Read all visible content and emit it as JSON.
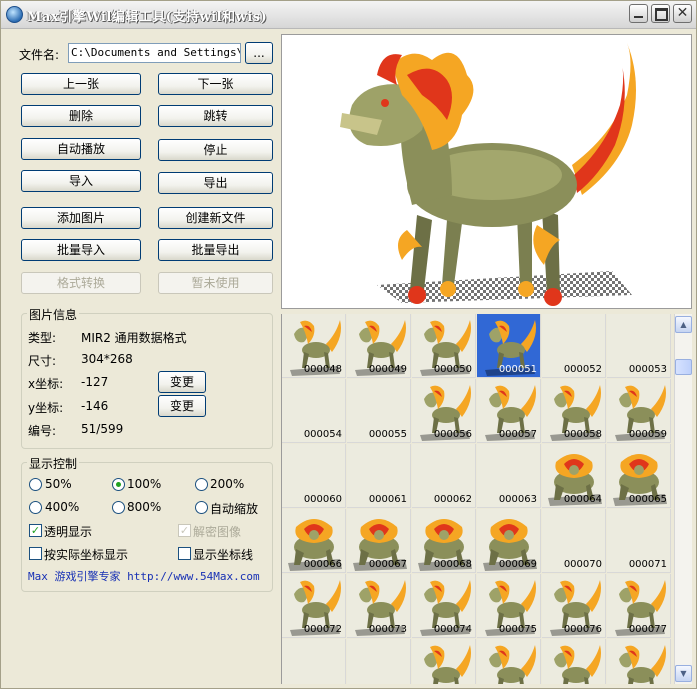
{
  "window": {
    "title": "Max引擎Wil编辑工具(支持wil和wis)"
  },
  "file": {
    "label": "文件名:",
    "path": "C:\\Documents and Settings\\Ad",
    "browse_label": "..."
  },
  "buttons": {
    "prev": "上一张",
    "next": "下一张",
    "delete": "删除",
    "jump": "跳转",
    "autoplay": "自动播放",
    "stop": "停止",
    "import": "导入",
    "export": "导出",
    "add_image": "添加图片",
    "create_file": "创建新文件",
    "batch_import": "批量导入",
    "batch_export": "批量导出",
    "format_convert": "格式转换",
    "unused": "暂未使用"
  },
  "info": {
    "title": "图片信息",
    "type_label": "类型:",
    "type_value": "MIR2  通用数据格式",
    "size_label": "尺寸:",
    "size_value": "304*268",
    "x_label": "x坐标:",
    "x_value": "-127",
    "x_change": "变更",
    "y_label": "y坐标:",
    "y_value": "-146",
    "y_change": "变更",
    "index_label": "编号:",
    "index_value": "51/599"
  },
  "display": {
    "title": "显示控制",
    "zoom": [
      {
        "label": "50%",
        "selected": false
      },
      {
        "label": "100%",
        "selected": true
      },
      {
        "label": "200%",
        "selected": false
      },
      {
        "label": "400%",
        "selected": false
      },
      {
        "label": "800%",
        "selected": false
      },
      {
        "label": "自动缩放",
        "selected": false
      }
    ],
    "transparent": {
      "label": "透明显示",
      "checked": true
    },
    "decrypt": {
      "label": "解密图像",
      "checked": true,
      "disabled": true
    },
    "actual_coords": {
      "label": "按实际坐标显示",
      "checked": false
    },
    "show_axes": {
      "label": "显示坐标线",
      "checked": false
    },
    "footer": "Max 游戏引擎专家 http://www.54Max.com"
  },
  "thumbnails": [
    {
      "id": "000048",
      "img": "walk"
    },
    {
      "id": "000049",
      "img": "walk"
    },
    {
      "id": "000050",
      "img": "walk"
    },
    {
      "id": "000051",
      "img": "walk",
      "selected": true
    },
    {
      "id": "000052",
      "img": ""
    },
    {
      "id": "000053",
      "img": ""
    },
    {
      "id": "000054",
      "img": ""
    },
    {
      "id": "000055",
      "img": ""
    },
    {
      "id": "000056",
      "img": "walk"
    },
    {
      "id": "000057",
      "img": "walk"
    },
    {
      "id": "000058",
      "img": "walk"
    },
    {
      "id": "000059",
      "img": "walk"
    },
    {
      "id": "000060",
      "img": ""
    },
    {
      "id": "000061",
      "img": ""
    },
    {
      "id": "000062",
      "img": ""
    },
    {
      "id": "000063",
      "img": ""
    },
    {
      "id": "000064",
      "img": "front"
    },
    {
      "id": "000065",
      "img": "front"
    },
    {
      "id": "000066",
      "img": "front"
    },
    {
      "id": "000067",
      "img": "front"
    },
    {
      "id": "000068",
      "img": "front"
    },
    {
      "id": "000069",
      "img": "front"
    },
    {
      "id": "000070",
      "img": ""
    },
    {
      "id": "000071",
      "img": ""
    },
    {
      "id": "000072",
      "img": "walk"
    },
    {
      "id": "000073",
      "img": "walk"
    },
    {
      "id": "000074",
      "img": "walk"
    },
    {
      "id": "000075",
      "img": "walk"
    },
    {
      "id": "000076",
      "img": "walk"
    },
    {
      "id": "000077",
      "img": "walk"
    },
    {
      "id": "",
      "img": ""
    },
    {
      "id": "",
      "img": ""
    },
    {
      "id": "",
      "img": "walk"
    },
    {
      "id": "",
      "img": "walk"
    },
    {
      "id": "",
      "img": "walk"
    },
    {
      "id": "",
      "img": "walk"
    }
  ],
  "colors": {
    "selection": "#3168d5",
    "link": "#1730b4",
    "flame": "#f5a623",
    "body": "#8b8f5a"
  }
}
